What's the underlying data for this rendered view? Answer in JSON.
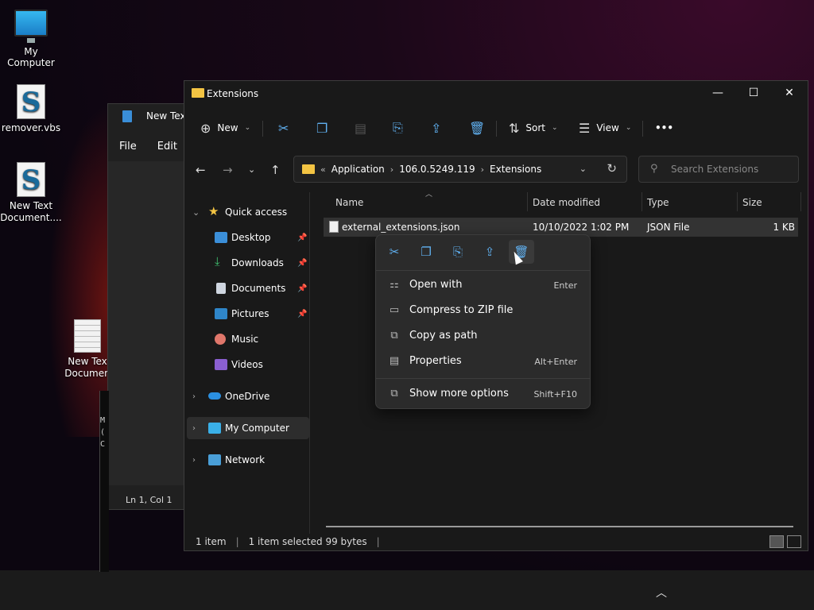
{
  "desktop": {
    "icons": [
      {
        "label": "My Computer"
      },
      {
        "label": "remover.vbs"
      },
      {
        "label": "New Text Document...."
      },
      {
        "label": "New Tex Documen"
      }
    ]
  },
  "notepad": {
    "title": "New Text",
    "menu": [
      "File",
      "Edit"
    ],
    "status": "Ln 1, Col 1"
  },
  "cmd": {
    "lines": [
      "M",
      "(",
      "C"
    ]
  },
  "explorer": {
    "title": "Extensions",
    "window_controls": {
      "minimize": "—",
      "maximize": "☐",
      "close": "✕"
    },
    "toolbar": {
      "new_label": "New",
      "sort_label": "Sort",
      "view_label": "View",
      "more_label": "•••"
    },
    "address": {
      "crumbs": [
        "Application",
        "106.0.5249.119",
        "Extensions"
      ],
      "prefix": "«"
    },
    "search_placeholder": "Search Extensions",
    "sidebar": {
      "quick_access": "Quick access",
      "items": [
        {
          "label": "Desktop",
          "pinned": true
        },
        {
          "label": "Downloads",
          "pinned": true
        },
        {
          "label": "Documents",
          "pinned": true
        },
        {
          "label": "Pictures",
          "pinned": true
        },
        {
          "label": "Music",
          "pinned": false
        },
        {
          "label": "Videos",
          "pinned": false
        }
      ],
      "onedrive": "OneDrive",
      "my_computer": "My Computer",
      "network": "Network"
    },
    "columns": {
      "name": "Name",
      "date": "Date modified",
      "type": "Type",
      "size": "Size"
    },
    "files": [
      {
        "name": "external_extensions.json",
        "date": "10/10/2022 1:02 PM",
        "type": "JSON File",
        "size": "1 KB"
      }
    ],
    "status": {
      "count": "1 item",
      "selected": "1 item selected  99 bytes"
    }
  },
  "context_menu": {
    "items": [
      {
        "label": "Open with",
        "shortcut": "Enter"
      },
      {
        "label": "Compress to ZIP file",
        "shortcut": ""
      },
      {
        "label": "Copy as path",
        "shortcut": ""
      },
      {
        "label": "Properties",
        "shortcut": "Alt+Enter"
      },
      {
        "label": "Show more options",
        "shortcut": "Shift+F10"
      }
    ]
  },
  "colors": {
    "accent": "#60b0f0",
    "folder": "#f3c443",
    "window_bg": "#191919",
    "menu_bg": "#2b2b2b"
  }
}
